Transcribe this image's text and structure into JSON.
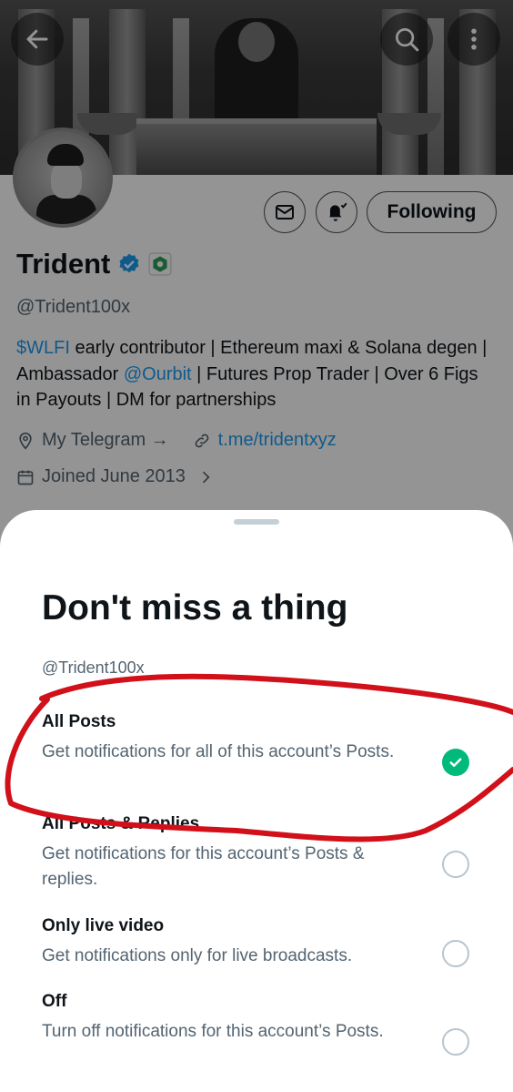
{
  "header": {
    "back_icon": "arrow-left-icon",
    "search_icon": "search-icon",
    "more_icon": "more-vertical-icon"
  },
  "profile": {
    "name": "Trident",
    "handle": "@Trident100x",
    "following_label": "Following",
    "bio": {
      "cashtag": "$WLFI",
      "text1": " early contributor | Ethereum maxi & Solana degen | Ambassador ",
      "mention": "@Ourbit",
      "text2": " | Futures Prop Trader | Over 6 Figs in Payouts | DM for partnerships"
    },
    "location": "My Telegram →",
    "website": "t.me/tridentxyz",
    "joined": "Joined June 2013",
    "colors": {
      "link": "#1d9bf0",
      "verified": "#1d9bf0",
      "affiliate_badge": "#2e9e5b"
    }
  },
  "sheet": {
    "title": "Don't miss a thing",
    "handle": "@Trident100x",
    "options": [
      {
        "title": "All Posts",
        "desc": "Get notifications for all of this account’s Posts.",
        "selected": true
      },
      {
        "title": "All Posts & Replies",
        "desc": "Get notifications for this account’s Posts & replies.",
        "selected": false
      },
      {
        "title": "Only live video",
        "desc": "Get notifications only for live broadcasts.",
        "selected": false
      },
      {
        "title": "Off",
        "desc": "Turn off notifications for this account’s Posts.",
        "selected": false
      }
    ],
    "colors": {
      "selected": "#00ba7c",
      "annotation": "#d1101a"
    }
  }
}
